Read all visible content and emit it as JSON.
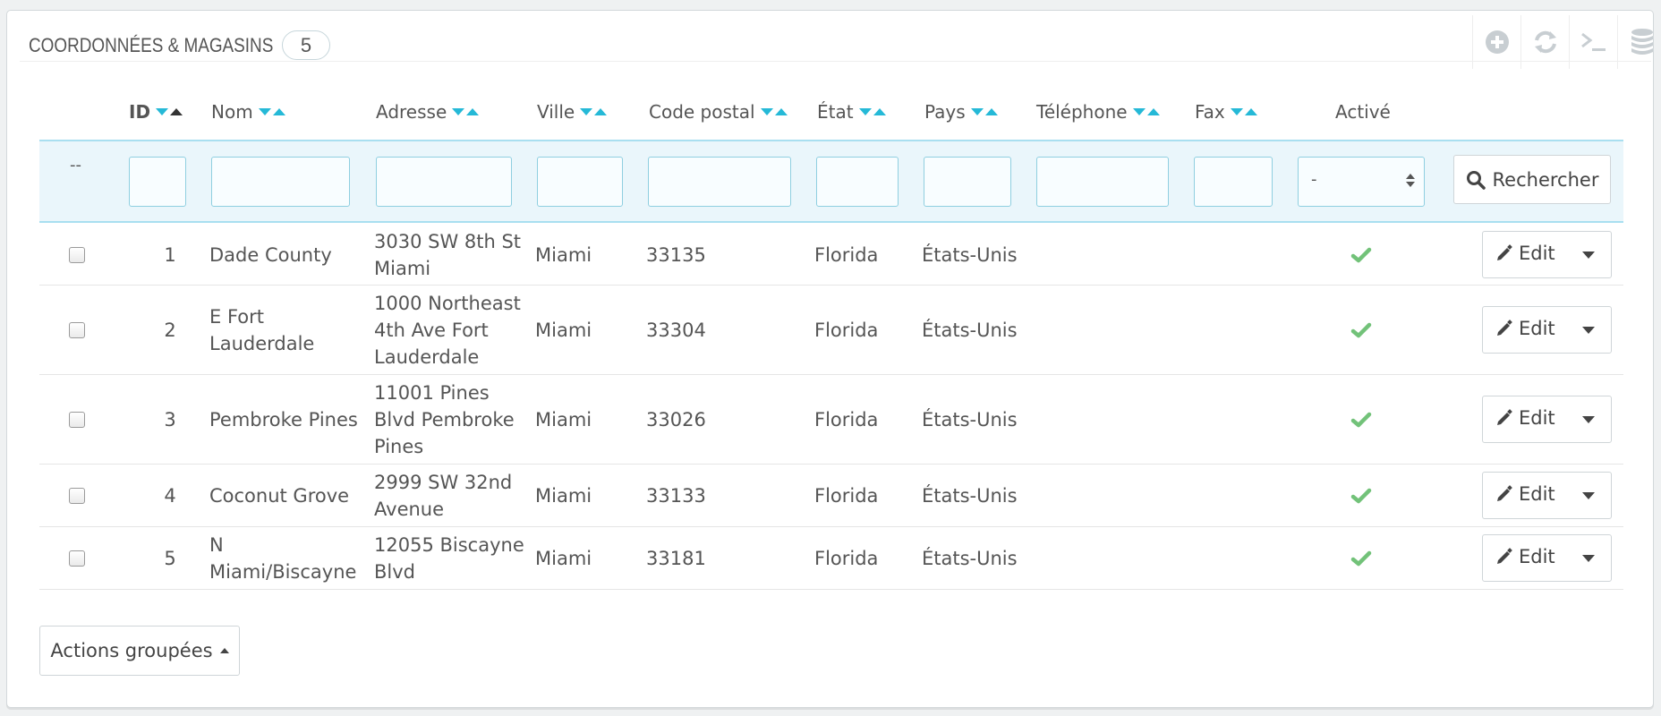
{
  "panel": {
    "title": "COORDONNÉES & MAGASINS",
    "count": "5",
    "toolbar": [
      {
        "icon": "add-icon"
      },
      {
        "icon": "refresh-icon"
      },
      {
        "icon": "sql-console-icon"
      },
      {
        "icon": "database-export-icon"
      }
    ]
  },
  "columns": {
    "id": "ID",
    "nom": "Nom",
    "adresse": "Adresse",
    "ville": "Ville",
    "code_postal": "Code postal",
    "etat": "État",
    "pays": "Pays",
    "telephone": "Téléphone",
    "fax": "Fax",
    "active": "Activé"
  },
  "filters": {
    "dashdash": "--",
    "active_select_value": "-",
    "search_label": "Rechercher"
  },
  "rows": [
    {
      "id": "1",
      "name": "Dade County",
      "address": "3030 SW 8th St Miami",
      "city": "Miami",
      "zip": "33135",
      "state": "Florida",
      "country": "États-Unis",
      "phone": "",
      "fax": "",
      "active": true,
      "edit_label": "Edit"
    },
    {
      "id": "2",
      "name": "E Fort Lauderdale",
      "address": "1000 Northeast 4th Ave Fort Lauderdale",
      "city": "Miami",
      "zip": "33304",
      "state": "Florida",
      "country": "États-Unis",
      "phone": "",
      "fax": "",
      "active": true,
      "edit_label": "Edit"
    },
    {
      "id": "3",
      "name": "Pembroke Pines",
      "address": "11001 Pines Blvd Pembroke Pines",
      "city": "Miami",
      "zip": "33026",
      "state": "Florida",
      "country": "États-Unis",
      "phone": "",
      "fax": "",
      "active": true,
      "edit_label": "Edit"
    },
    {
      "id": "4",
      "name": "Coconut Grove",
      "address": "2999 SW 32nd Avenue",
      "city": "Miami",
      "zip": "33133",
      "state": "Florida",
      "country": "États-Unis",
      "phone": "",
      "fax": "",
      "active": true,
      "edit_label": "Edit"
    },
    {
      "id": "5",
      "name": "N Miami/Biscayne",
      "address": "12055 Biscayne Blvd",
      "city": "Miami",
      "zip": "33181",
      "state": "Florida",
      "country": "États-Unis",
      "phone": "",
      "fax": "",
      "active": true,
      "edit_label": "Edit"
    }
  ],
  "bulk_actions_label": "Actions groupées",
  "colors": {
    "accent": "#25b9d7",
    "check": "#72c279",
    "filter_bg": "#eaf6fb"
  }
}
